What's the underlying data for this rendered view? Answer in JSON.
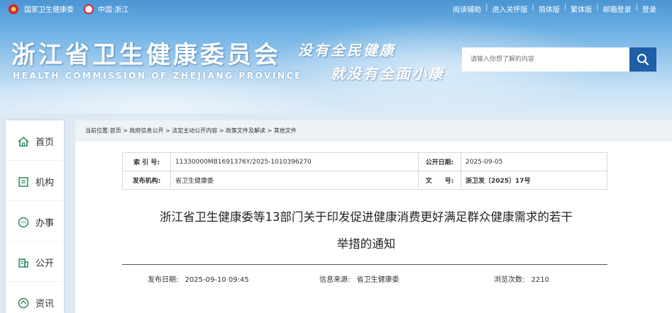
{
  "topbar": {
    "left_links": [
      "国家卫生健康委",
      "中国·浙江"
    ],
    "right_links": [
      "阅读辅助",
      "进入关怀版",
      "简体版",
      "繁体版",
      "邮箱登录",
      "登录"
    ]
  },
  "header": {
    "title": "浙江省卫生健康委员会",
    "subtitle": "HEALTH COMMISSION OF ZHEJIANG PROVINCE",
    "slogan_line1": "没有全民健康",
    "slogan_line2": "就没有全面小康"
  },
  "search": {
    "placeholder": "请输入你想了解的内容",
    "icon": "search-icon"
  },
  "nav": {
    "items": [
      {
        "label": "首页",
        "icon": "home-icon"
      },
      {
        "label": "机构",
        "icon": "building-icon"
      },
      {
        "label": "办事",
        "icon": "chat-icon"
      },
      {
        "label": "公开",
        "icon": "document-icon"
      },
      {
        "label": "资讯",
        "icon": "news-icon"
      }
    ]
  },
  "breadcrumb": "当前位置:首页 > 政府信息公开 > 法定主动公开内容 > 政策文件及解读 > 其他文件",
  "meta": {
    "index_label": "索 引 号:",
    "index_value": "11330000MB1691376Y/2025-1010396270",
    "date_label": "公开日期:",
    "date_value": "2025-09-05",
    "org_label": "发布机构:",
    "org_value": "省卫生健康委",
    "docno_label": "文　　号:",
    "docno_value": "浙卫发〔2025〕17号"
  },
  "document": {
    "title_line1": "浙江省卫生健康委等13部门关于印发促进健康消费更好满足群众健康需求的若干",
    "title_line2": "举措的通知"
  },
  "info": {
    "publish_label": "发布日期:",
    "publish_value": "2025-09-10 09:45",
    "source_label": "信息来源:",
    "source_value": "省卫生健康委",
    "views_label": "浏览次数:",
    "views_value": "2210"
  },
  "colors": {
    "search_button": "#1e5fa8",
    "header_top": "#4b95d3"
  }
}
